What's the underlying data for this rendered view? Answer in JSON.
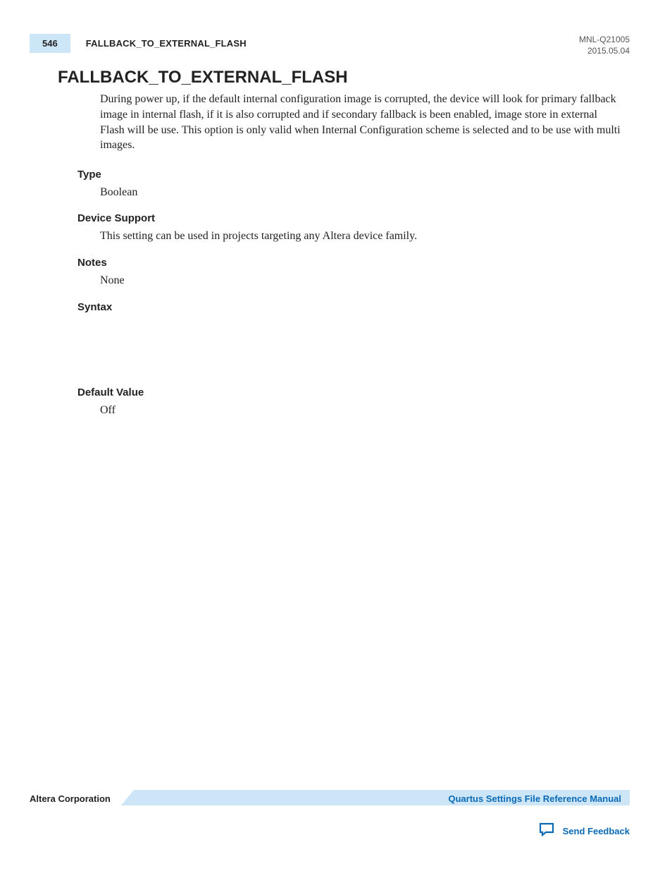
{
  "header": {
    "page_number": "546",
    "section_title": "FALLBACK_TO_EXTERNAL_FLASH",
    "doc_id": "MNL-Q21005",
    "date": "2015.05.04"
  },
  "main": {
    "title": "FALLBACK_TO_EXTERNAL_FLASH",
    "description": "During power up, if the default internal configuration image is corrupted, the device will look for primary fallback image in internal flash, if it is also corrupted and if secondary fallback is been enabled, image store in external Flash will be use. This option is only valid when Internal Configuration scheme is selected and to be use with multi images.",
    "sections": {
      "type": {
        "heading": "Type",
        "body": "Boolean"
      },
      "device_support": {
        "heading": "Device Support",
        "body": "This setting can be used in projects targeting any Altera device family."
      },
      "notes": {
        "heading": "Notes",
        "body": "None"
      },
      "syntax": {
        "heading": "Syntax",
        "body": ""
      },
      "default_value": {
        "heading": "Default Value",
        "body": "Off"
      }
    }
  },
  "footer": {
    "company": "Altera Corporation",
    "manual": "Quartus Settings File Reference Manual",
    "feedback": "Send Feedback"
  }
}
